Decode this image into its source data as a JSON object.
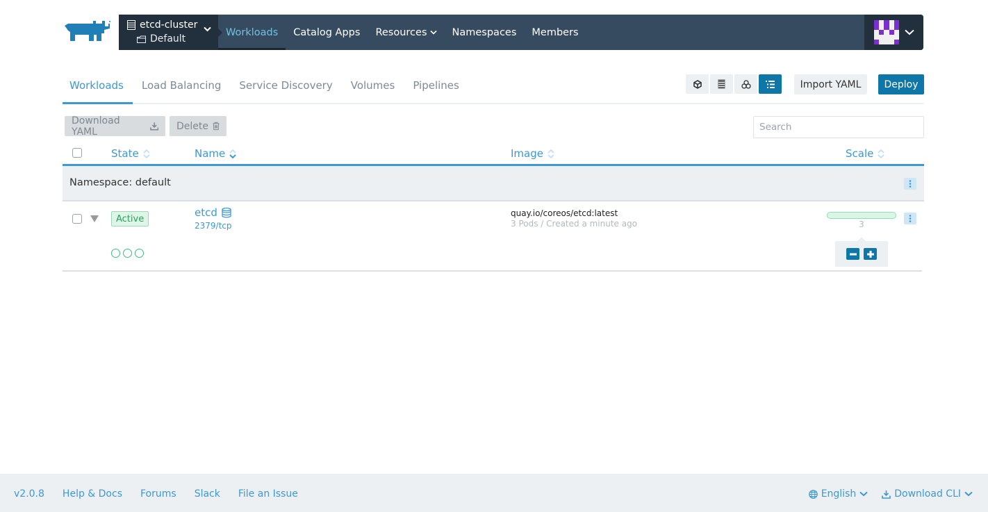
{
  "header": {
    "logo": "rancher-logo",
    "cluster": {
      "name": "etcd-cluster",
      "project": "Default"
    },
    "nav": [
      {
        "label": "Workloads",
        "active": true,
        "dropdown": false
      },
      {
        "label": "Catalog Apps",
        "active": false,
        "dropdown": false
      },
      {
        "label": "Resources",
        "active": false,
        "dropdown": true
      },
      {
        "label": "Namespaces",
        "active": false,
        "dropdown": false
      },
      {
        "label": "Members",
        "active": false,
        "dropdown": false
      }
    ],
    "user_menu": {
      "avatar": "identicon",
      "avatar_color": "#7b2fd0"
    }
  },
  "tabs": [
    {
      "label": "Workloads",
      "active": true
    },
    {
      "label": "Load Balancing",
      "active": false
    },
    {
      "label": "Service Discovery",
      "active": false
    },
    {
      "label": "Volumes",
      "active": false
    },
    {
      "label": "Pipelines",
      "active": false
    }
  ],
  "view_toggles": [
    {
      "icon": "cube-icon",
      "active": false
    },
    {
      "icon": "server-icon",
      "active": false
    },
    {
      "icon": "cubes-icon",
      "active": false
    },
    {
      "icon": "list-icon",
      "active": true
    }
  ],
  "toolbar": {
    "import_label": "Import YAML",
    "deploy_label": "Deploy",
    "download_label": "Download YAML",
    "delete_label": "Delete",
    "search_placeholder": "Search",
    "search_value": ""
  },
  "table": {
    "columns": [
      {
        "label": "State",
        "sort": "none"
      },
      {
        "label": "Name",
        "sort": "desc"
      },
      {
        "label": "Image",
        "sort": "none"
      },
      {
        "label": "Scale",
        "sort": "none"
      }
    ],
    "groups": [
      {
        "label": "Namespace: default",
        "rows": [
          {
            "state": "Active",
            "name": "etcd",
            "type_icon": "database-icon",
            "endpoint": "2379/tcp",
            "image": "quay.io/coreos/etcd:latest",
            "detail": "3 Pods / Created a minute ago",
            "pods": 3,
            "scale": "3",
            "scale_fraction": 1.0
          }
        ]
      }
    ]
  },
  "colors": {
    "accent": "#3d98d3",
    "primary_button": "#0f76a8",
    "topbar": "#364b60",
    "topbar_dark": "#222f3c",
    "active_green": "#22a559"
  },
  "footer": {
    "version": "v2.0.8",
    "links": [
      "Help & Docs",
      "Forums",
      "Slack",
      "File an Issue"
    ],
    "language": "English",
    "download_cli": "Download CLI"
  }
}
